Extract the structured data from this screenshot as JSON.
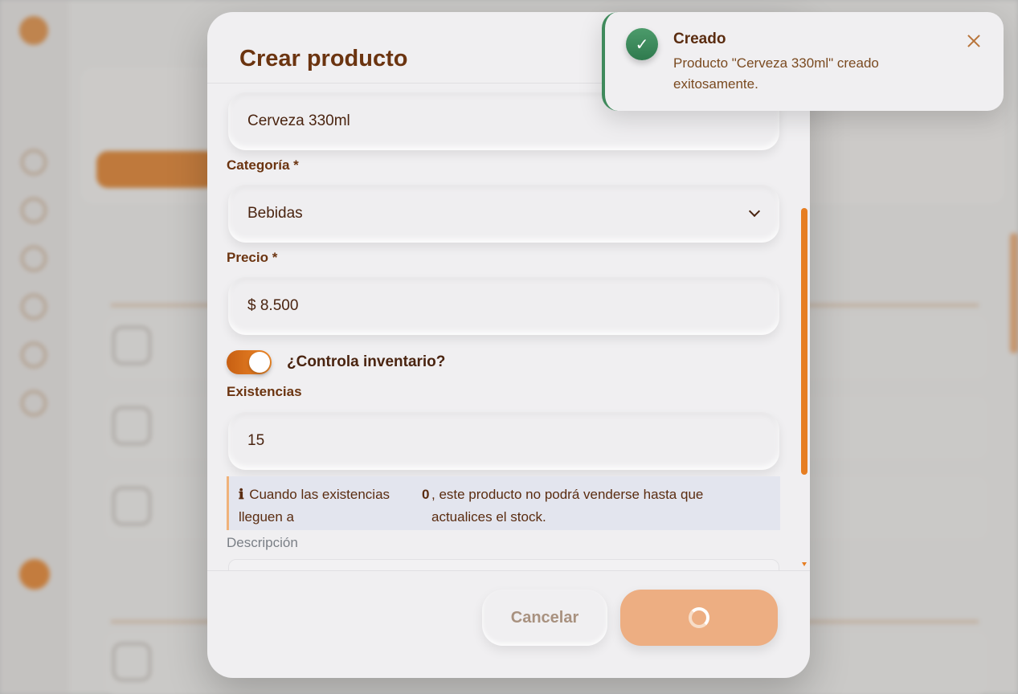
{
  "modal": {
    "title": "Crear producto",
    "fields": {
      "name_value": "Cerveza 330ml",
      "category_label": "Categoría *",
      "category_value": "Bebidas",
      "price_label": "Precio *",
      "price_value": "$ 8.500",
      "inventory_toggle_label": "¿Controla inventario?",
      "inventory_toggle_on": true,
      "stock_label": "Existencias",
      "stock_value": "15",
      "description_label": "Descripción"
    },
    "info": {
      "icon": "ℹ",
      "text_part1": "Cuando las existencias lleguen a",
      "zero": "0",
      "text_part2": ", este producto no podrá venderse hasta que actualices el stock."
    },
    "buttons": {
      "cancel_label": "Cancelar",
      "submit_state": "loading"
    }
  },
  "toast": {
    "icon": "check-icon",
    "check_glyph": "✓",
    "title": "Creado",
    "message": "Producto \"Cerveza 330ml\" creado exitosamente.",
    "status_color": "#3f8a5c"
  },
  "colors": {
    "accent": "#e67e22",
    "title_brown": "#6b3410",
    "info_bg": "#e3e5ee"
  }
}
